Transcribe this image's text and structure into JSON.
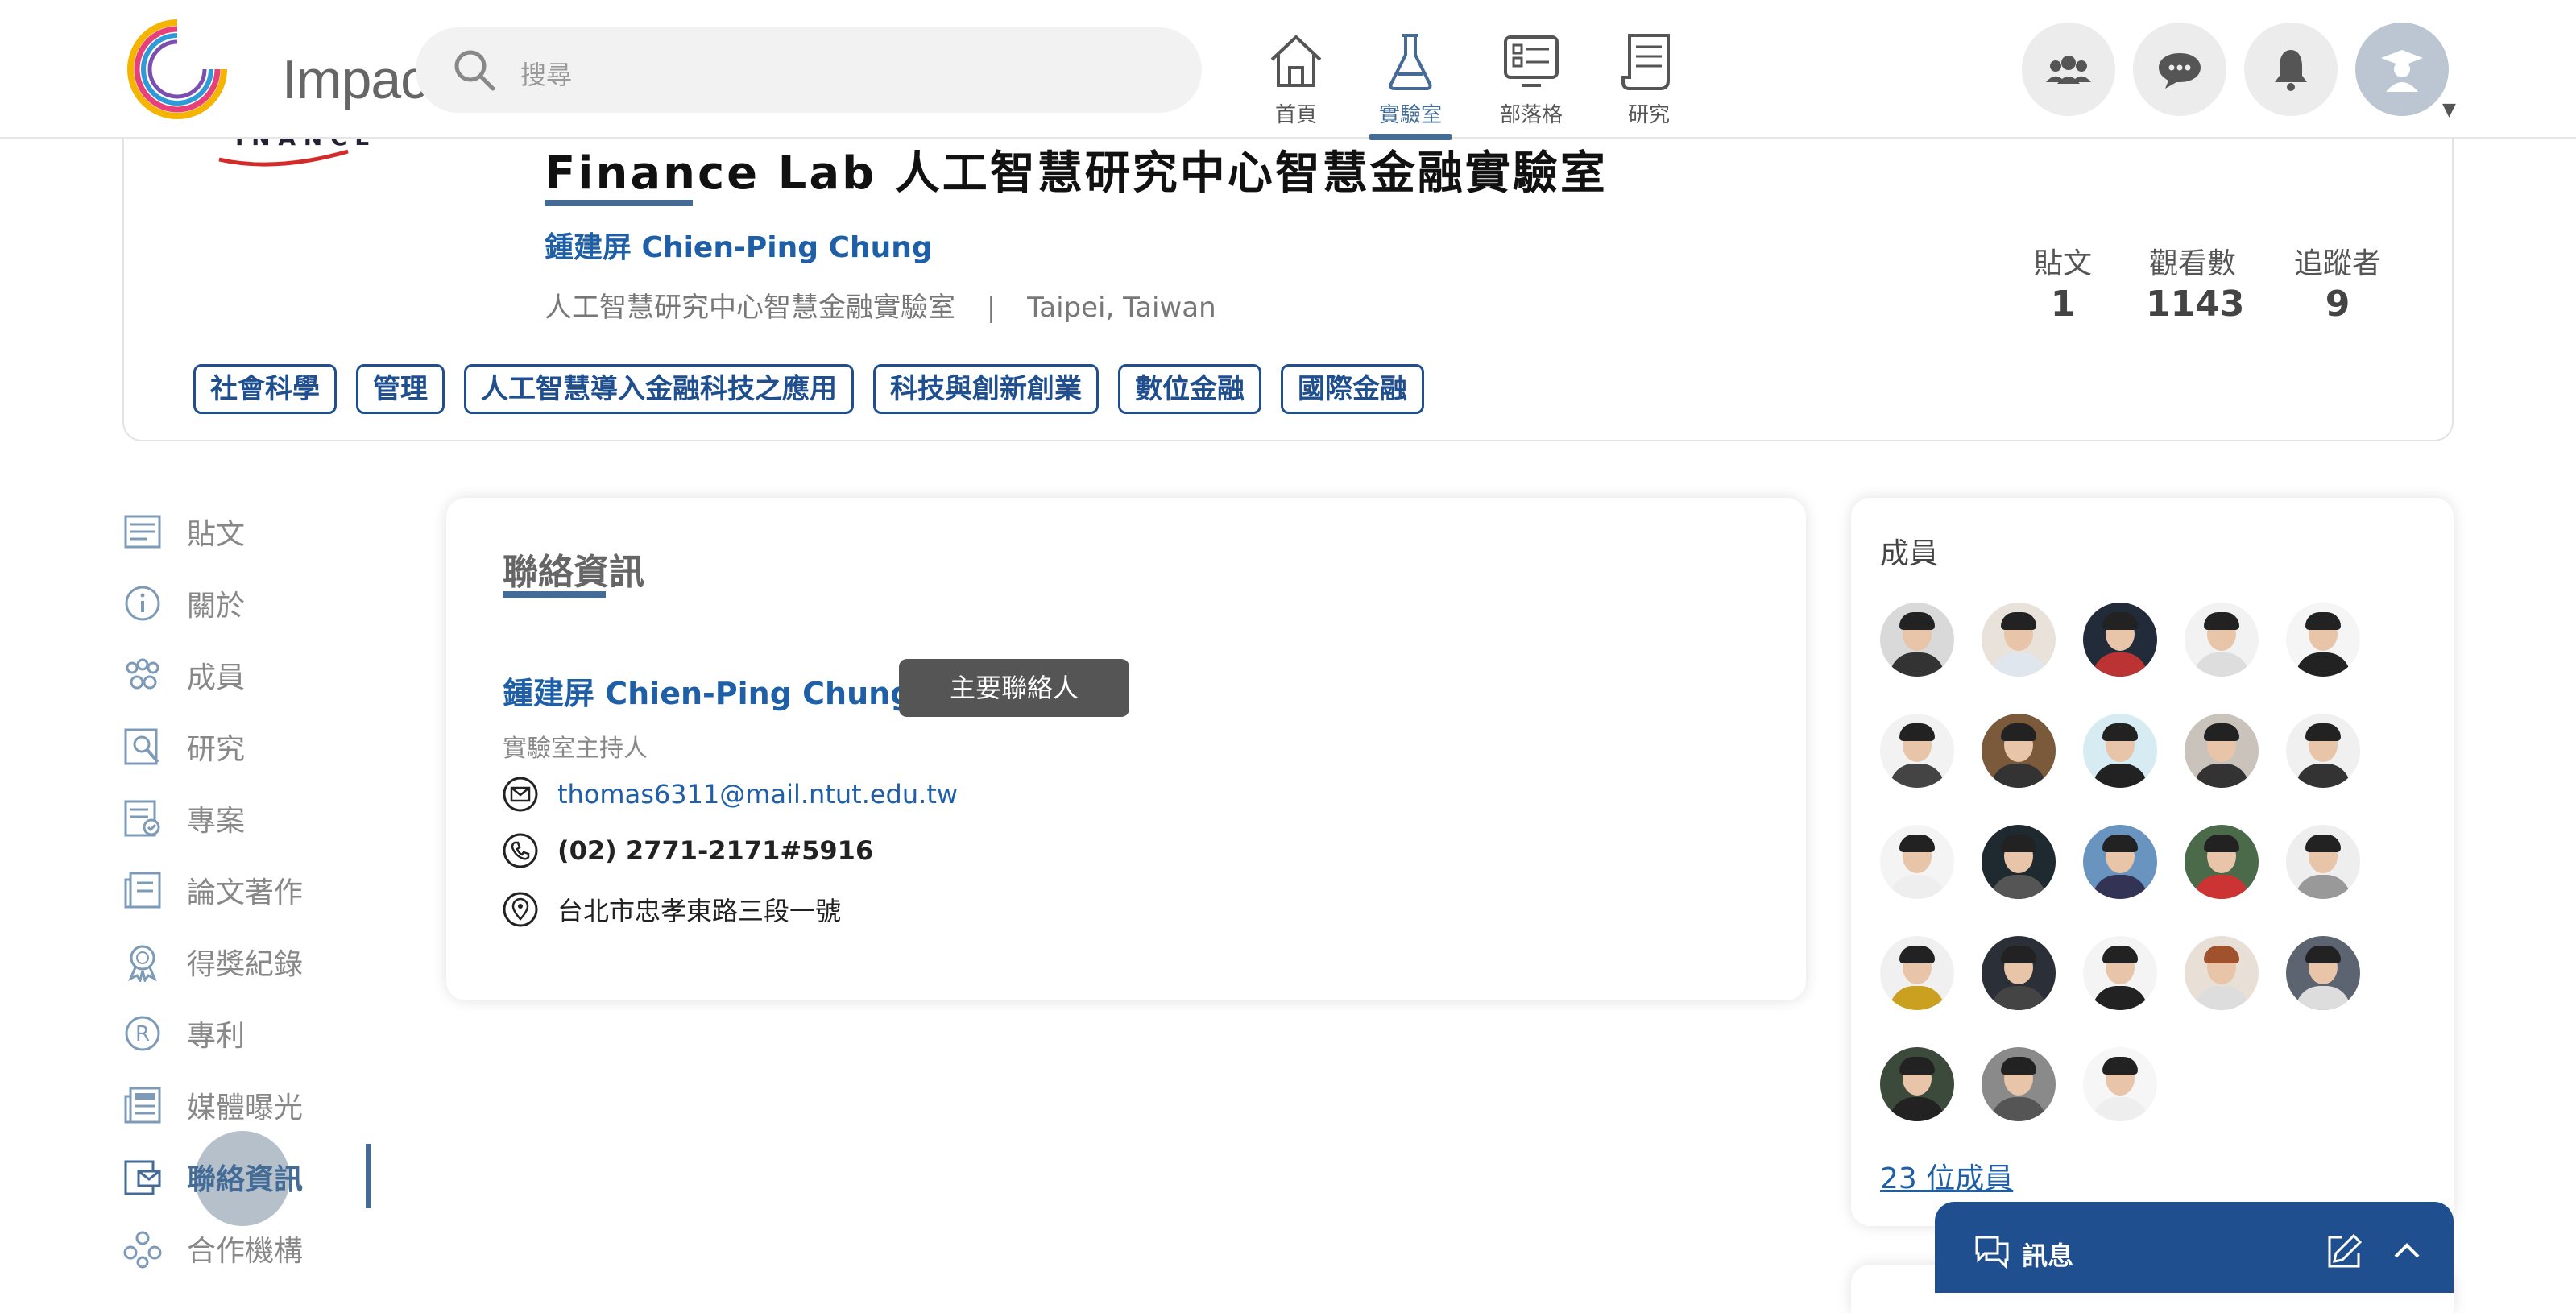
{
  "app": {
    "name": "Impactio",
    "brand_color": "#436b95",
    "link_color": "#1f5fa8"
  },
  "search": {
    "placeholder": "搜尋"
  },
  "nav": [
    {
      "label": "首頁",
      "icon": "home-icon"
    },
    {
      "label": "實驗室",
      "icon": "flask-icon",
      "active": true
    },
    {
      "label": "部落格",
      "icon": "blog-icon"
    },
    {
      "label": "研究",
      "icon": "scroll-icon"
    }
  ],
  "header_actions": [
    {
      "icon": "people-icon"
    },
    {
      "icon": "chat-icon"
    },
    {
      "icon": "bell-icon"
    },
    {
      "icon": "graduate-avatar-icon"
    }
  ],
  "lab": {
    "title": "Finance Lab 人工智慧研究中心智慧金融實驗室",
    "owner": "鍾建屏 Chien-Ping Chung",
    "affiliation": "人工智慧研究中心智慧金融實驗室",
    "separator": "|",
    "location": "Taipei,  Taiwan",
    "tags": [
      "社會科學",
      "管理",
      "人工智慧導入金融科技之應用",
      "科技與創新創業",
      "數位金融",
      "國際金融"
    ]
  },
  "stats": [
    {
      "label": "貼文",
      "value": "1"
    },
    {
      "label": "觀看數",
      "value": "1143"
    },
    {
      "label": "追蹤者",
      "value": "9"
    }
  ],
  "sidebar": {
    "items": [
      {
        "label": "貼文",
        "icon": "posts-icon"
      },
      {
        "label": "關於",
        "icon": "info-icon"
      },
      {
        "label": "成員",
        "icon": "members-icon"
      },
      {
        "label": "研究",
        "icon": "research-icon"
      },
      {
        "label": "專案",
        "icon": "project-icon"
      },
      {
        "label": "論文著作",
        "icon": "papers-icon"
      },
      {
        "label": "得獎紀錄",
        "icon": "award-icon"
      },
      {
        "label": "專利",
        "icon": "patent-icon"
      },
      {
        "label": "媒體曝光",
        "icon": "news-icon"
      },
      {
        "label": "聯絡資訊",
        "icon": "contact-icon",
        "active": true
      },
      {
        "label": "合作機構",
        "icon": "partners-icon"
      }
    ]
  },
  "contact": {
    "title": "聯絡資訊",
    "name": "鍾建屏 Chien-Ping Chung",
    "badge": "主要聯絡人",
    "role": "實驗室主持人",
    "email": "thomas6311@mail.ntut.edu.tw",
    "phone": "(02) 2771-2171#5916",
    "address": "台北市忠孝東路三段一號"
  },
  "members": {
    "title": "成員",
    "count_label": "23 位成員"
  },
  "messages": {
    "label": "訊息"
  }
}
